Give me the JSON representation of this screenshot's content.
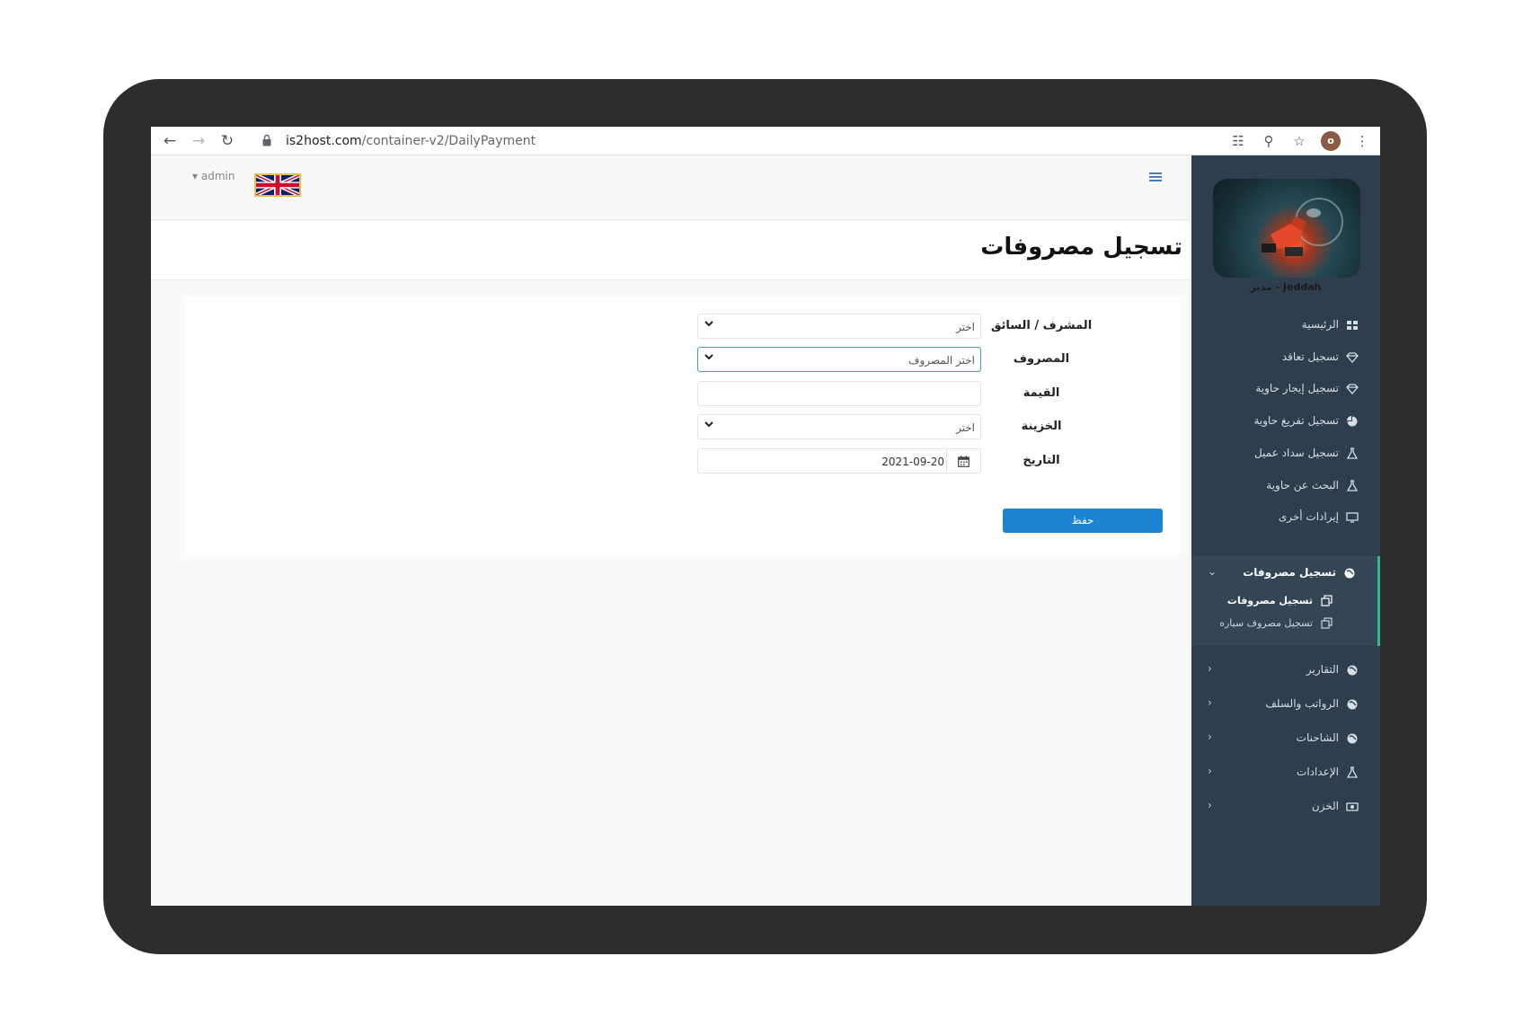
{
  "browser": {
    "url_host": "is2host.com",
    "url_path": "/container-v2/DailyPayment",
    "profile_initial": "o"
  },
  "topbar": {
    "user_label": "admin",
    "language_flag": "uk-flag-icon"
  },
  "page": {
    "title": "تسجيل مصروفات"
  },
  "form": {
    "fields": [
      {
        "label": "المشرف / السائق",
        "value": "اختر",
        "type": "select"
      },
      {
        "label": "المصروف",
        "value": "اختر المصروف",
        "type": "select"
      },
      {
        "label": "القيمة",
        "value": "",
        "type": "text"
      },
      {
        "label": "الخزينة",
        "value": "اختر",
        "type": "select"
      },
      {
        "label": "التاريخ",
        "value": "2021-09-20",
        "type": "date"
      }
    ],
    "save_label": "حفظ"
  },
  "sidebar": {
    "user_caption": "Jeddah - مدير",
    "items": [
      {
        "label": "الرئيسية",
        "icon": "grid-icon"
      },
      {
        "label": "تسجيل تعاقد",
        "icon": "diamond-icon"
      },
      {
        "label": "تسجيل إيجار حاوية",
        "icon": "diamond-icon"
      },
      {
        "label": "تسجيل تفريغ حاوية",
        "icon": "pie-chart-icon"
      },
      {
        "label": "تسجيل سداد عميل",
        "icon": "flask-icon"
      },
      {
        "label": "البحث عن حاوية",
        "icon": "flask-icon"
      },
      {
        "label": "إيرادات أخرى",
        "icon": "monitor-icon"
      },
      {
        "label": "تسجيل مصروفات",
        "icon": "globe-icon"
      },
      {
        "label": "التقارير",
        "icon": "globe-icon"
      },
      {
        "label": "الرواتب والسلف",
        "icon": "globe-icon"
      },
      {
        "label": "الشاحنات",
        "icon": "globe-icon"
      },
      {
        "label": "الإعدادات",
        "icon": "flask-icon"
      },
      {
        "label": "الخزن",
        "icon": "money-icon"
      }
    ],
    "sub_items": [
      {
        "label": "تسجيل مصروفات",
        "icon": "copy-icon",
        "active": true
      },
      {
        "label": "تسجيل مصروف سياره",
        "icon": "copy-icon",
        "active": false
      }
    ]
  },
  "colors": {
    "sidebar_bg": "#2e3e4f",
    "accent": "#2fb88f",
    "primary_button": "#1a84d2",
    "device_frame": "#2d2d2d"
  }
}
